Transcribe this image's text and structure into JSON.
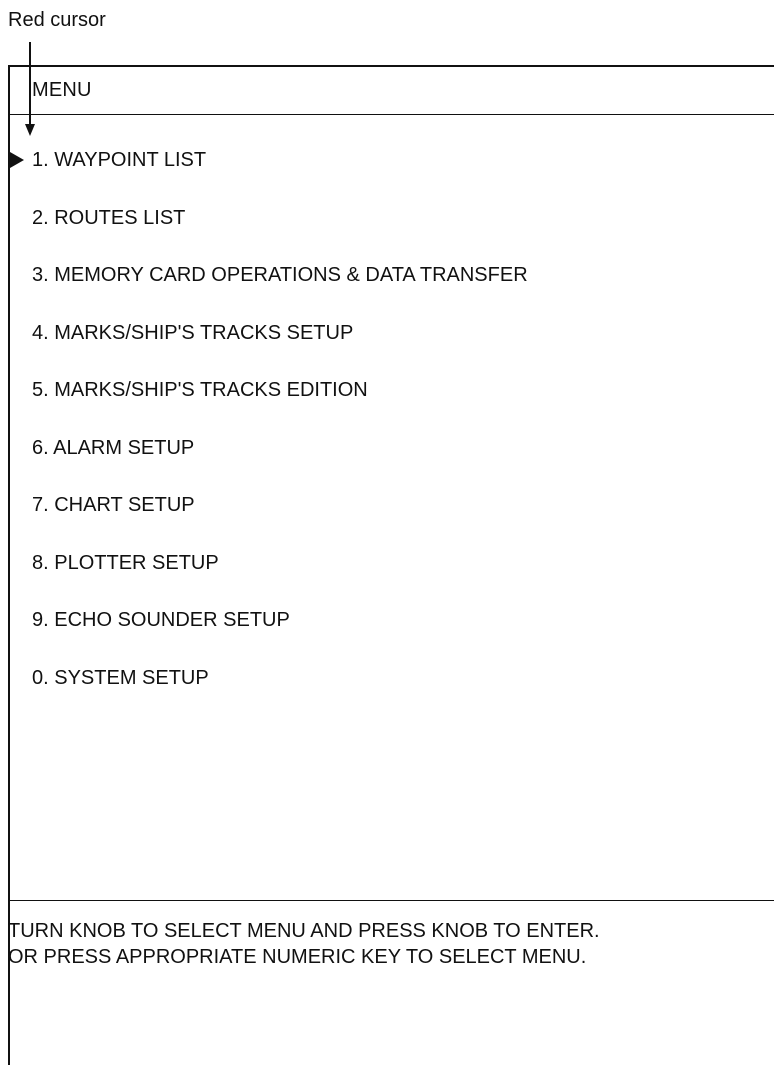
{
  "callout": {
    "label": "Red cursor"
  },
  "menu": {
    "title": "MENU",
    "selected_index": 0,
    "items": [
      {
        "label": "1. WAYPOINT LIST"
      },
      {
        "label": "2. ROUTES LIST"
      },
      {
        "label": "3. MEMORY CARD OPERATIONS & DATA TRANSFER"
      },
      {
        "label": "4. MARKS/SHIP'S TRACKS SETUP"
      },
      {
        "label": "5. MARKS/SHIP'S TRACKS EDITION"
      },
      {
        "label": "6. ALARM SETUP"
      },
      {
        "label": "7. CHART SETUP"
      },
      {
        "label": "8. PLOTTER SETUP"
      },
      {
        "label": "9. ECHO SOUNDER SETUP"
      },
      {
        "label": "0. SYSTEM SETUP"
      }
    ]
  },
  "footer": {
    "line1": "TURN KNOB TO SELECT MENU AND PRESS KNOB TO ENTER.",
    "line2": "OR PRESS APPROPRIATE NUMERIC KEY TO SELECT MENU."
  },
  "colors": {
    "cursor": "#111111",
    "text": "#111111",
    "background": "#ffffff"
  },
  "icons": {
    "cursor": "right-pointing-triangle"
  }
}
